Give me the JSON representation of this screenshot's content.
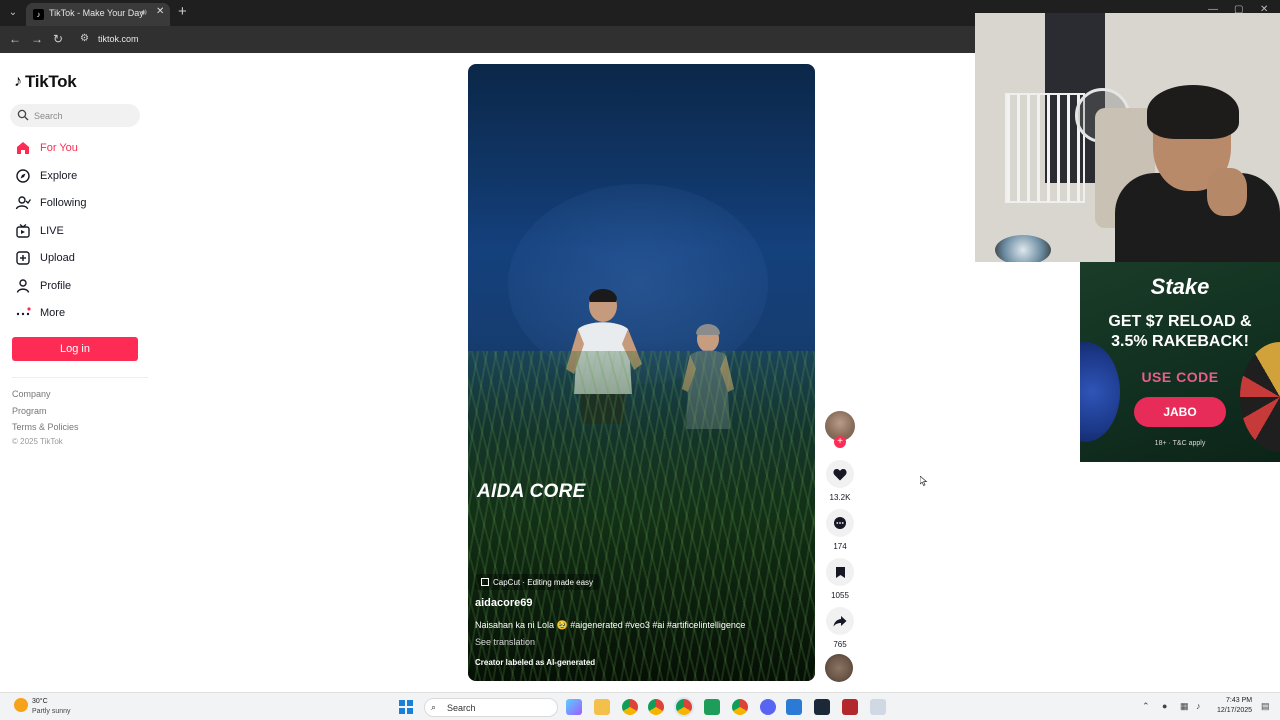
{
  "browser": {
    "tab_title": "TikTok - Make Your Day",
    "tab_close": "✕",
    "new_tab": "+",
    "url": "tiktok.com"
  },
  "sidebar": {
    "logo_text": "TikTok",
    "search_placeholder": "Search",
    "nav": [
      {
        "label": "For You",
        "icon": "home-icon",
        "active": true
      },
      {
        "label": "Explore",
        "icon": "compass-icon"
      },
      {
        "label": "Following",
        "icon": "following-icon"
      },
      {
        "label": "LIVE",
        "icon": "live-icon"
      },
      {
        "label": "Upload",
        "icon": "upload-icon"
      },
      {
        "label": "Profile",
        "icon": "profile-icon"
      },
      {
        "label": "More",
        "icon": "more-icon"
      }
    ],
    "login_label": "Log in",
    "footer": {
      "company": "Company",
      "program": "Program",
      "terms": "Terms & Policies",
      "copyright": "© 2025 TikTok"
    }
  },
  "video": {
    "overlay_title": "AIDA CORE",
    "capcut_badge": "CapCut · Editing made easy",
    "username": "aidacore69",
    "caption": "Naisahan ka ni Lola 🥹 #aigenerated #veo3 #ai #artificelintelligence",
    "see_translation": "See translation",
    "ai_label": "Creator labeled as AI-generated"
  },
  "actions": {
    "likes": "13.2K",
    "comments": "174",
    "saves": "1055",
    "shares": "765"
  },
  "ad": {
    "brand": "Stake",
    "headline_line1": "GET $7 RELOAD &",
    "headline_line2": "3.5% RAKEBACK!",
    "code_label": "USE CODE",
    "code": "JABO",
    "terms": "18+ · T&C apply"
  },
  "taskbar": {
    "weather_temp": "30°C",
    "weather_desc": "Partly sunny",
    "search_label": "Search",
    "time": "7:43 PM",
    "date": "12/17/2025"
  },
  "colors": {
    "brand_red": "#fe2c55",
    "ad_green": "#123121"
  }
}
